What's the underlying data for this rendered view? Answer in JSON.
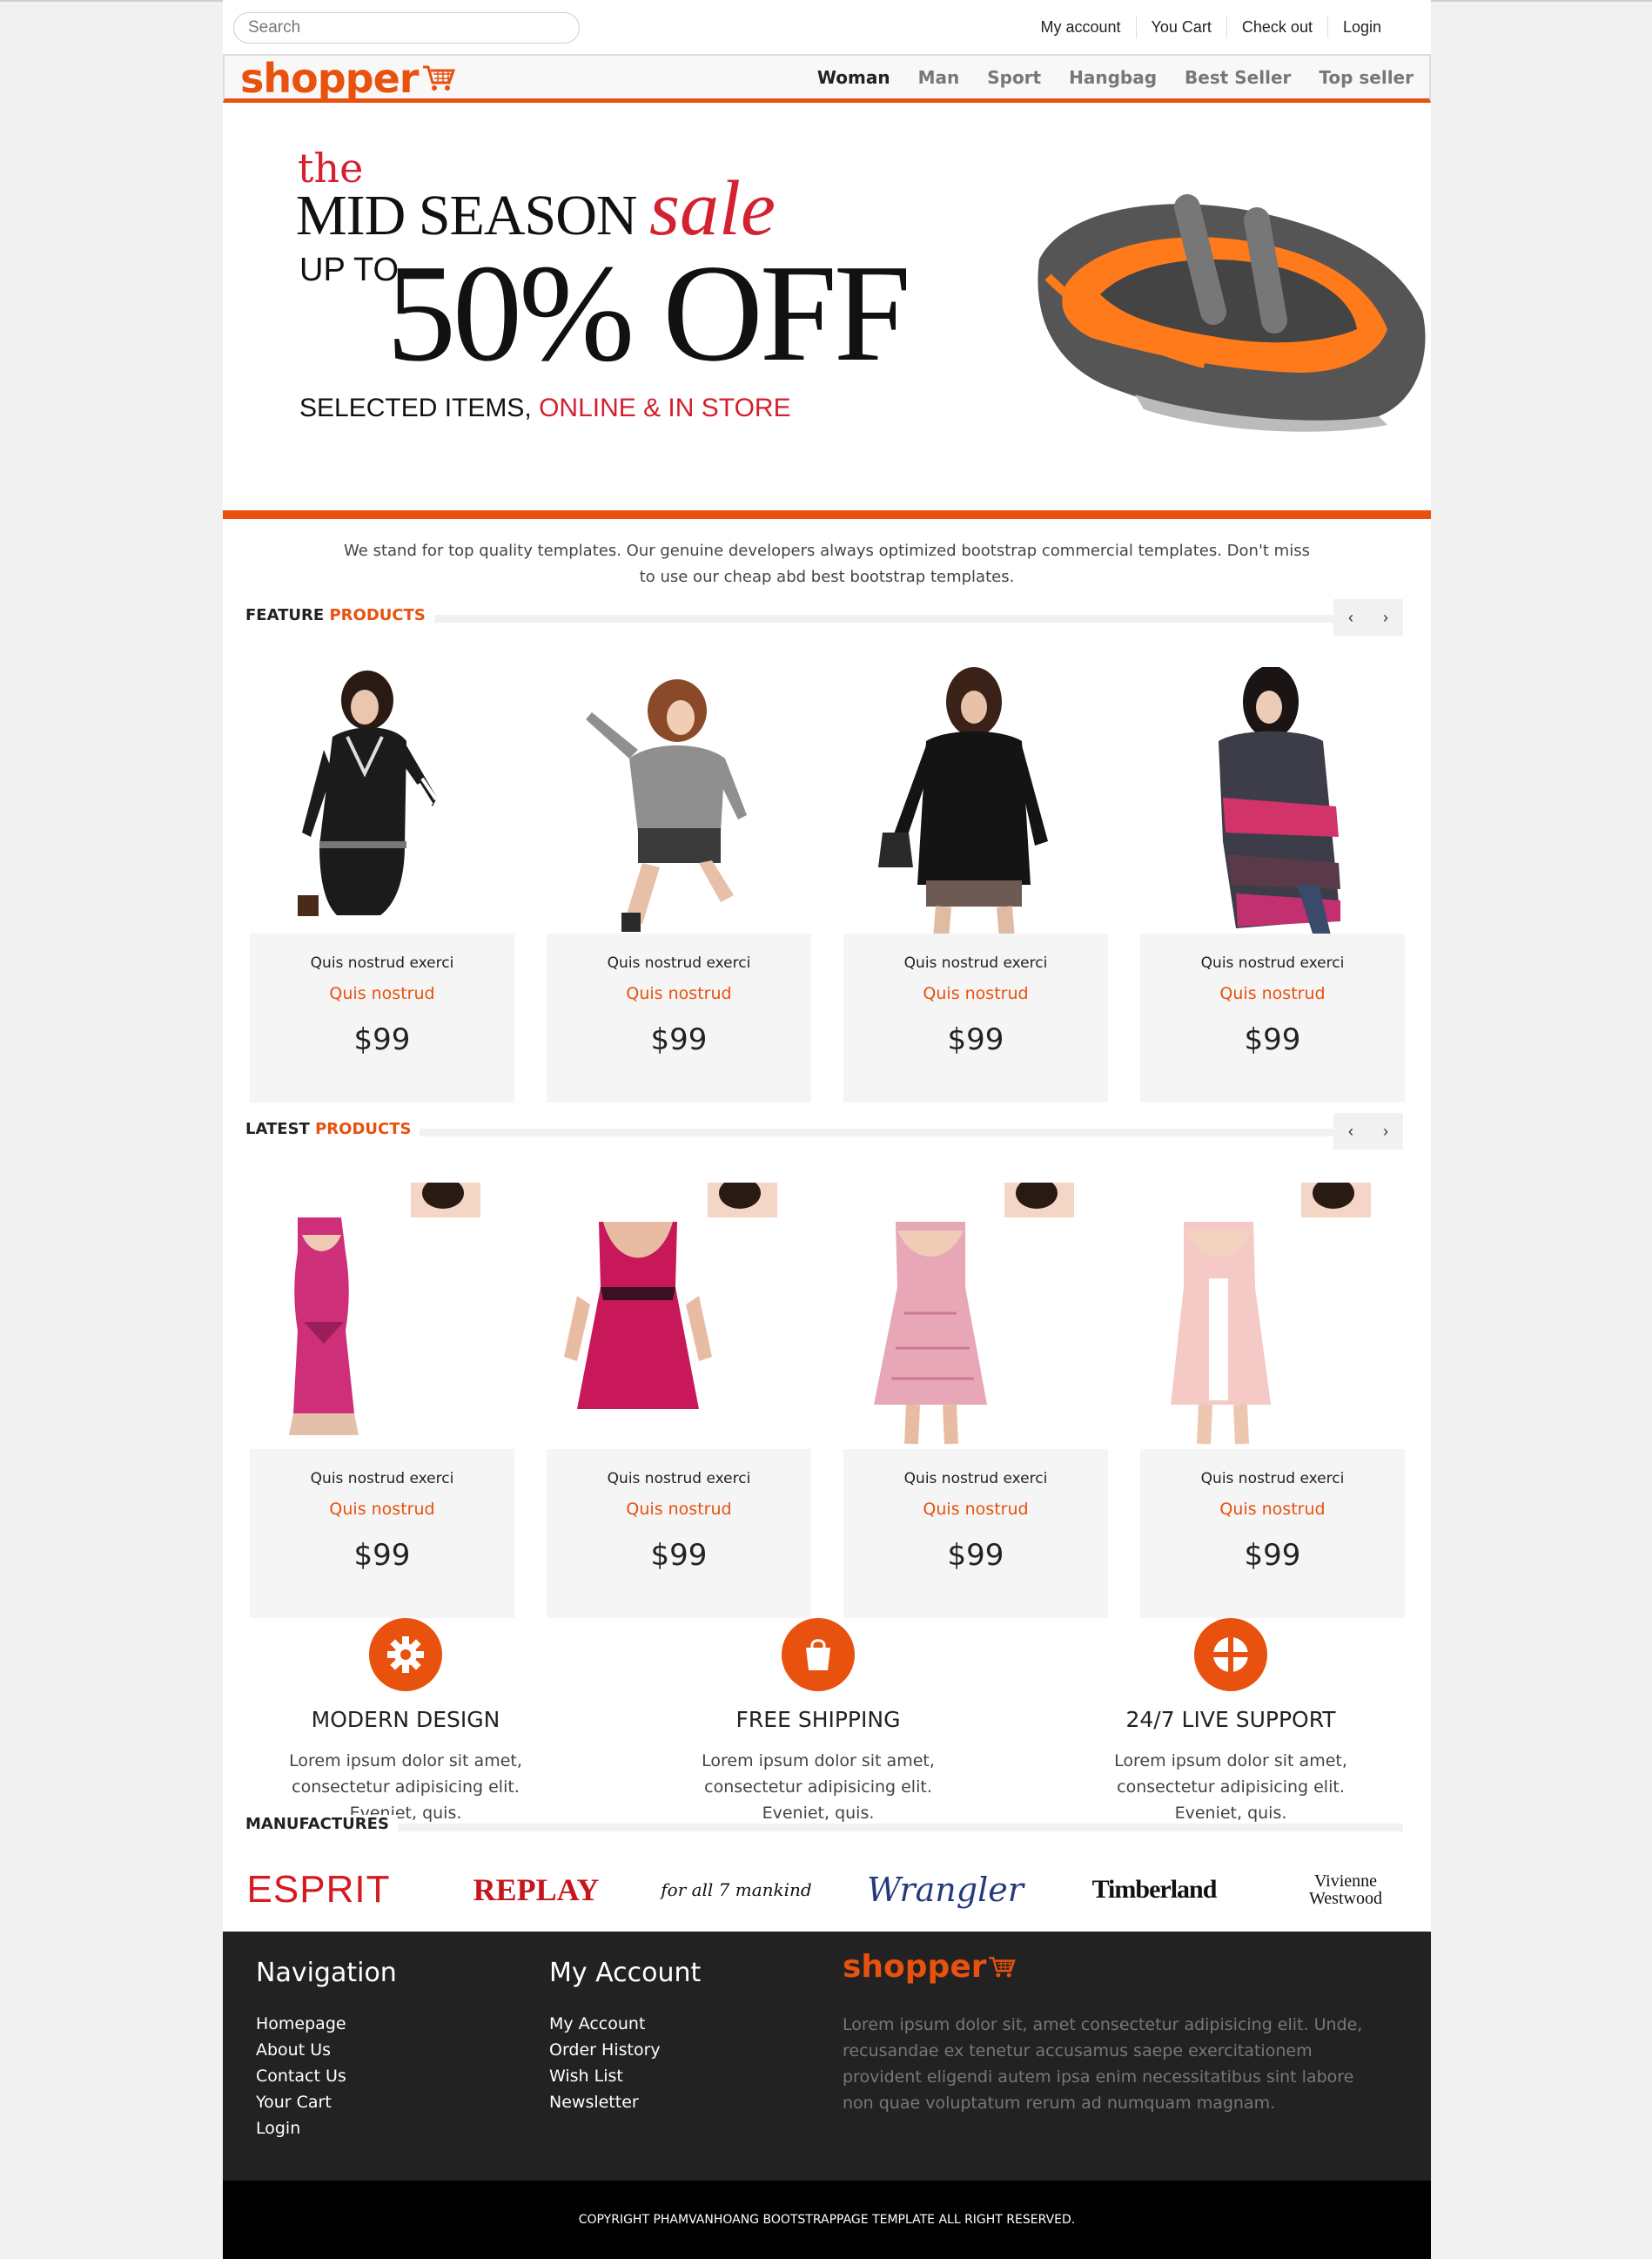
{
  "search": {
    "placeholder": "Search"
  },
  "top_links": [
    "My account",
    "You Cart",
    "Check out",
    "Login"
  ],
  "brand": {
    "name": "shopper"
  },
  "nav": [
    "Woman",
    "Man",
    "Sport",
    "Hangbag",
    "Best Seller",
    "Top seller"
  ],
  "banner": {
    "the": "the",
    "mid": "MID SEASON",
    "sale": "sale",
    "upto": "UP TO",
    "off": "50% OFF",
    "selected": "SELECTED ITEMS,",
    "online": "ONLINE & IN STORE"
  },
  "intro": "We stand for top quality templates. Our genuine developers always optimized bootstrap commercial templates. Don't miss to use our cheap abd best bootstrap templates.",
  "feature_section": {
    "title": "FEATURE",
    "accent": "PRODUCTS"
  },
  "latest_section": {
    "title": "LATEST",
    "accent": "PRODUCTS"
  },
  "arrows": {
    "prev": "‹",
    "next": "›"
  },
  "feature_products": [
    {
      "name": "Quis nostrud exerci",
      "sub": "Quis nostrud",
      "price": "$99"
    },
    {
      "name": "Quis nostrud exerci",
      "sub": "Quis nostrud",
      "price": "$99"
    },
    {
      "name": "Quis nostrud exerci",
      "sub": "Quis nostrud",
      "price": "$99"
    },
    {
      "name": "Quis nostrud exerci",
      "sub": "Quis nostrud",
      "price": "$99"
    }
  ],
  "latest_products": [
    {
      "name": "Quis nostrud exerci",
      "sub": "Quis nostrud",
      "price": "$99"
    },
    {
      "name": "Quis nostrud exerci",
      "sub": "Quis nostrud",
      "price": "$99"
    },
    {
      "name": "Quis nostrud exerci",
      "sub": "Quis nostrud",
      "price": "$99"
    },
    {
      "name": "Quis nostrud exerci",
      "sub": "Quis nostrud",
      "price": "$99"
    }
  ],
  "features": [
    {
      "icon": "gear-icon",
      "title": "MODERN DESIGN",
      "text": "Lorem ipsum dolor sit amet, consectetur adipisicing elit. Eveniet, quis."
    },
    {
      "icon": "shopping-bag-icon",
      "title": "FREE SHIPPING",
      "text": "Lorem ipsum dolor sit amet, consectetur adipisicing elit. Eveniet, quis."
    },
    {
      "icon": "support-lifebuoy-icon",
      "title": "24/7 LIVE SUPPORT",
      "text": "Lorem ipsum dolor sit amet, consectetur adipisicing elit. Eveniet, quis."
    }
  ],
  "manufactures": {
    "title": "MANUFACTURES",
    "brands": [
      "ESPRIT",
      "REPLAY",
      "for all 7 mankind",
      "Wrangler",
      "Timberland",
      "Vivienne Westwood"
    ]
  },
  "footer": {
    "navigation": {
      "title": "Navigation",
      "items": [
        "Homepage",
        "About Us",
        "Contact Us",
        "Your Cart",
        "Login"
      ]
    },
    "account": {
      "title": "My Account",
      "items": [
        "My Account",
        "Order History",
        "Wish List",
        "Newsletter"
      ]
    },
    "brand": "shopper",
    "description": "Lorem ipsum dolor sit, amet consectetur adipisicing elit. Unde, recusandae ex tenetur accusamus saepe exercitationem provident eligendi autem ipsa enim necessitatibus sint labore non quae voluptatum rerum ad numquam magnam.",
    "copyright": "COPYRIGHT PHAMVANHOANG BOOTSTRAPPAGE TEMPLATE ALL RIGHT RESERVED."
  },
  "colors": {
    "accent": "#e8510e",
    "sale_red": "#d42030",
    "footer_bg": "#222222"
  }
}
